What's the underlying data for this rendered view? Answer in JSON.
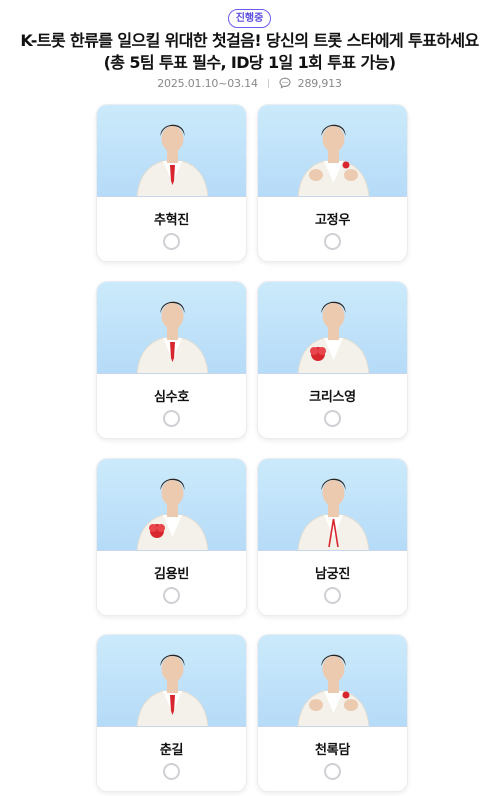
{
  "header": {
    "status_badge": "진행중",
    "title": "K-트롯 한류를 일으킬 위대한 첫걸음! 당신의 트롯 스타에게 투표하세요 (총 5팀 투표 필수, ID당 1일 1회 투표 가능)",
    "period": "2025.01.10~03.14",
    "comment_count": "289,913"
  },
  "candidates": [
    {
      "name": "추혁진",
      "selected": false
    },
    {
      "name": "고정우",
      "selected": false
    },
    {
      "name": "심수호",
      "selected": false
    },
    {
      "name": "크리스영",
      "selected": false
    },
    {
      "name": "김용빈",
      "selected": false
    },
    {
      "name": "남궁진",
      "selected": false
    },
    {
      "name": "춘길",
      "selected": false
    },
    {
      "name": "천록담",
      "selected": false
    }
  ],
  "colors": {
    "accent": "#5a4de0",
    "photo_bg": "#c4e4fa",
    "suit": "#f4f1ea",
    "hair": "#2a2320",
    "skin": "#eccab0",
    "red": "#d8262f"
  }
}
